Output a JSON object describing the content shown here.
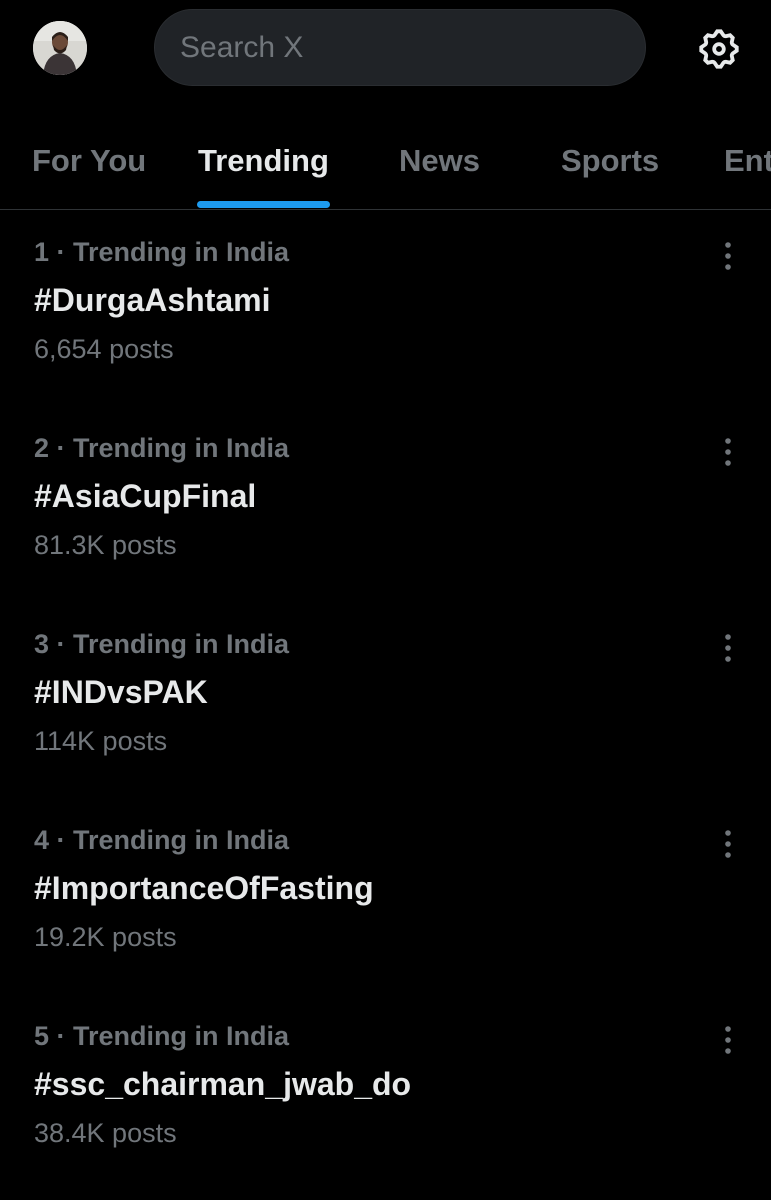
{
  "header": {
    "avatar_icon": "profile-photo",
    "search_placeholder": "Search X",
    "settings_icon": "gear-icon"
  },
  "tabs": [
    {
      "label": "For You",
      "active": false
    },
    {
      "label": "Trending",
      "active": true
    },
    {
      "label": "News",
      "active": false
    },
    {
      "label": "Sports",
      "active": false
    },
    {
      "label": "Ent",
      "active": false
    }
  ],
  "trends": [
    {
      "meta": "1 · Trending in India",
      "name": "#DurgaAshtami",
      "count": "6,654 posts"
    },
    {
      "meta": "2 · Trending in India",
      "name": "#AsiaCupFinal",
      "count": "81.3K posts"
    },
    {
      "meta": "3 · Trending in India",
      "name": "#INDvsPAK",
      "count": "114K posts"
    },
    {
      "meta": "4 · Trending in India",
      "name": "#ImportanceOfFasting",
      "count": "19.2K posts"
    },
    {
      "meta": "5 · Trending in India",
      "name": "#ssc_chairman_jwab_do",
      "count": "38.4K posts"
    }
  ],
  "colors": {
    "background": "#000000",
    "primary_text": "#e7e9ea",
    "secondary_text": "#71767b",
    "accent": "#1d9bf0",
    "search_bg": "#202327"
  }
}
